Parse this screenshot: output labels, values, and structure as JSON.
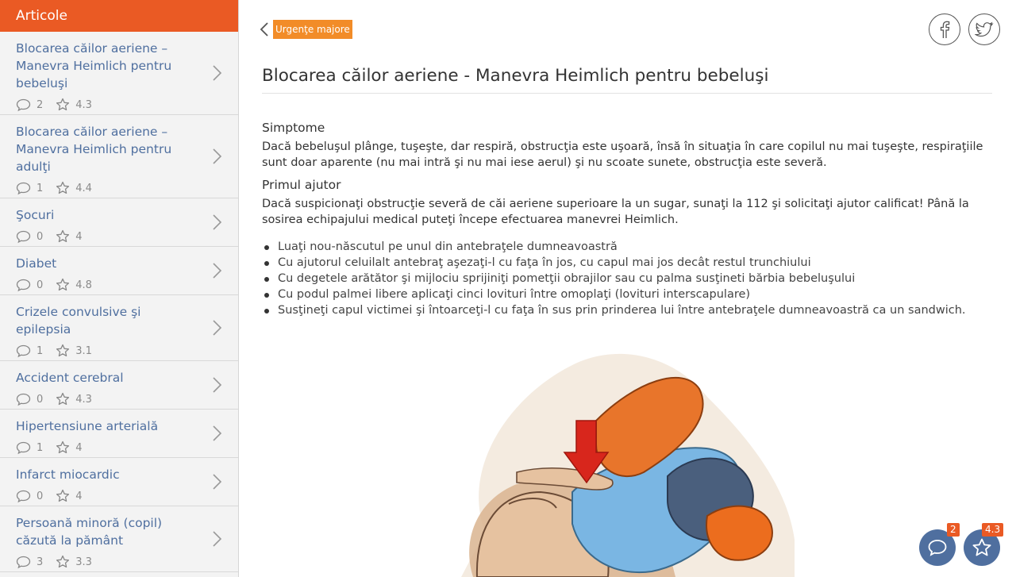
{
  "sidebar": {
    "header": "Articole",
    "items": [
      {
        "title": "Blocarea căilor aeriene – Manevra Heimlich pentru bebeluşi",
        "comments": "2",
        "rating": "4.3"
      },
      {
        "title": "Blocarea căilor aeriene – Manevra Heimlich pentru adulţi",
        "comments": "1",
        "rating": "4.4"
      },
      {
        "title": "Şocuri",
        "comments": "0",
        "rating": "4"
      },
      {
        "title": "Diabet",
        "comments": "0",
        "rating": "4.8"
      },
      {
        "title": "Crizele convulsive şi epilepsia",
        "comments": "1",
        "rating": "3.1"
      },
      {
        "title": "Accident cerebral",
        "comments": "0",
        "rating": "4.3"
      },
      {
        "title": "Hipertensiune arterială",
        "comments": "1",
        "rating": "4"
      },
      {
        "title": "Infarct miocardic",
        "comments": "0",
        "rating": "4"
      },
      {
        "title": "Persoană minoră (copil) căzută la pământ",
        "comments": "3",
        "rating": "3.3"
      }
    ]
  },
  "main": {
    "category": "Urgenţe majore",
    "title": "Blocarea căilor aeriene - Manevra Heimlich pentru bebeluşi",
    "sections": [
      {
        "heading": "Simptome",
        "text": "Dacă bebeluşul plânge, tuşeşte, dar respiră, obstrucţia este uşoară, însă în situaţia în care copilul nu mai tuşeşte, respiraţiile sunt doar aparente (nu mai intră şi nu mai iese aerul) şi nu scoate sunete, obstrucţia este severă."
      },
      {
        "heading": "Primul ajutor",
        "text": "Dacă suspicionaţi obstrucţie severă de căi aeriene superioare la un sugar, sunaţi la 112 şi solicitaţi ajutor calificat! Până la sosirea echipajului medical puteţi începe efectuarea manevrei Heimlich."
      }
    ],
    "steps": [
      "Luaţi nou-născutul pe unul din antebraţele dumneavoastră",
      "Cu ajutorul celuilalt antebraţ aşezaţi-l cu faţa în jos, cu capul mai jos decât restul trunchiului",
      "Cu degetele arătător şi mijlociu sprijiniţi pometţii obrajilor sau cu palma susţineti bărbia bebeluşului",
      "Cu podul palmei libere aplicaţi cinci lovituri între omoplaţi (lovituri interscapulare)",
      "Susţineţi capul victimei şi întoarceţi-l cu faţa în sus prin prinderea lui între antebraţele dumneavoastră ca un sandwich."
    ]
  },
  "floating": {
    "comments_count": "2",
    "rating_value": "4.3"
  },
  "icons": [
    "chevron-left-icon",
    "facebook-icon",
    "twitter-icon",
    "comment-icon",
    "star-icon",
    "chevron-right-icon"
  ],
  "colors": {
    "accent": "#ea5a24",
    "tag": "#f28c28",
    "link": "#4f6f9f",
    "fab": "#4f6f9f"
  }
}
